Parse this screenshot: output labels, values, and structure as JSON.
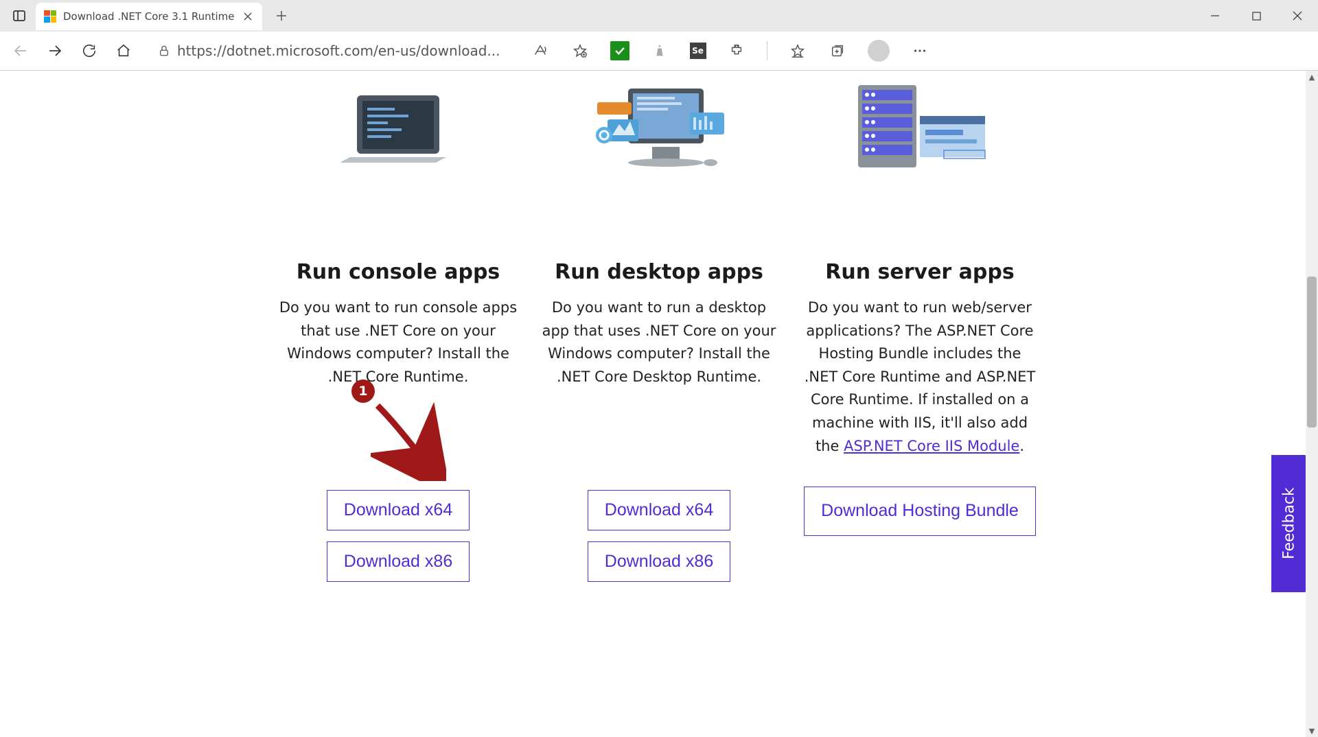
{
  "browser": {
    "tab_title": "Download .NET Core 3.1 Runtime",
    "url": "https://dotnet.microsoft.com/en-us/download..."
  },
  "cards": [
    {
      "heading": "Run console apps",
      "description": "Do you want to run console apps that use .NET Core on your Windows computer? Install the .NET Core Runtime.",
      "buttons": [
        "Download x64",
        "Download x86"
      ]
    },
    {
      "heading": "Run desktop apps",
      "description": "Do you want to run a desktop app that uses .NET Core on your Windows computer? Install the .NET Core Desktop Runtime.",
      "buttons": [
        "Download x64",
        "Download x86"
      ]
    },
    {
      "heading": "Run server apps",
      "description_pre": "Do you want to run web/server applications? The ASP.NET Core Hosting Bundle includes the .NET Core Runtime and ASP.NET Core Runtime. If installed on a machine with IIS, it'll also add the ",
      "description_link": "ASP.NET Core IIS Module",
      "description_post": ".",
      "buttons": [
        "Download Hosting Bundle"
      ]
    }
  ],
  "feedback_label": "Feedback",
  "annotation": {
    "number": "1"
  }
}
